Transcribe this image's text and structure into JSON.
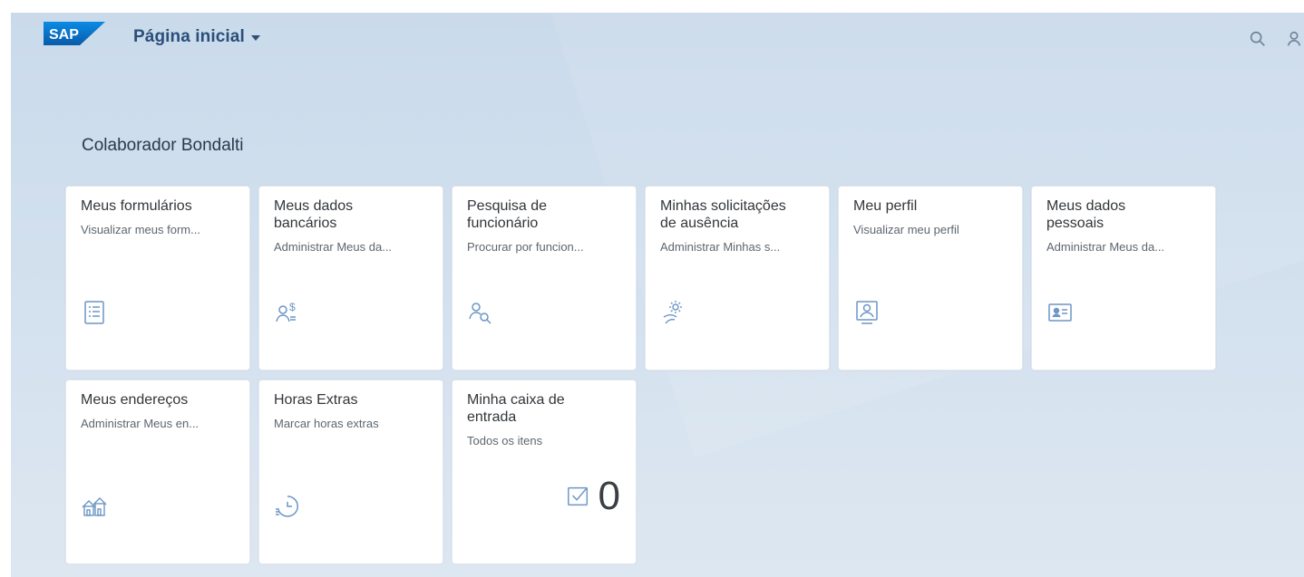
{
  "header": {
    "brand": "SAP",
    "title": "Página inicial"
  },
  "group": {
    "title": "Colaborador Bondalti"
  },
  "tiles": [
    {
      "title": "Meus formulários",
      "subtitle": "Visualizar meus form...",
      "icon": "form-icon"
    },
    {
      "title": "Meus dados\nbancários",
      "subtitle": "Administrar Meus da...",
      "icon": "bank-user-icon"
    },
    {
      "title": "Pesquisa de\nfuncionário",
      "subtitle": "Procurar por funcion...",
      "icon": "person-search-icon"
    },
    {
      "title": "Minhas solicitações\nde ausência",
      "subtitle": "Administrar Minhas s...",
      "icon": "vacation-icon"
    },
    {
      "title": "Meu perfil",
      "subtitle": "Visualizar meu perfil",
      "icon": "profile-icon"
    },
    {
      "title": "Meus dados\npessoais",
      "subtitle": "Administrar Meus da...",
      "icon": "id-card-icon"
    },
    {
      "title": "Meus endereços",
      "subtitle": "Administrar Meus en...",
      "icon": "home-icon"
    },
    {
      "title": "Horas Extras",
      "subtitle": "Marcar horas extras",
      "icon": "overtime-icon"
    },
    {
      "title": "Minha caixa de\nentrada",
      "subtitle": "Todos os itens",
      "icon": "inbox-check-icon",
      "count": "0"
    }
  ],
  "icons": {
    "search": "search-icon",
    "user": "user-icon"
  },
  "colors": {
    "brand": "#0a6ed1",
    "tile_icon": "#6c96c4",
    "background": "#d2e0ee"
  }
}
